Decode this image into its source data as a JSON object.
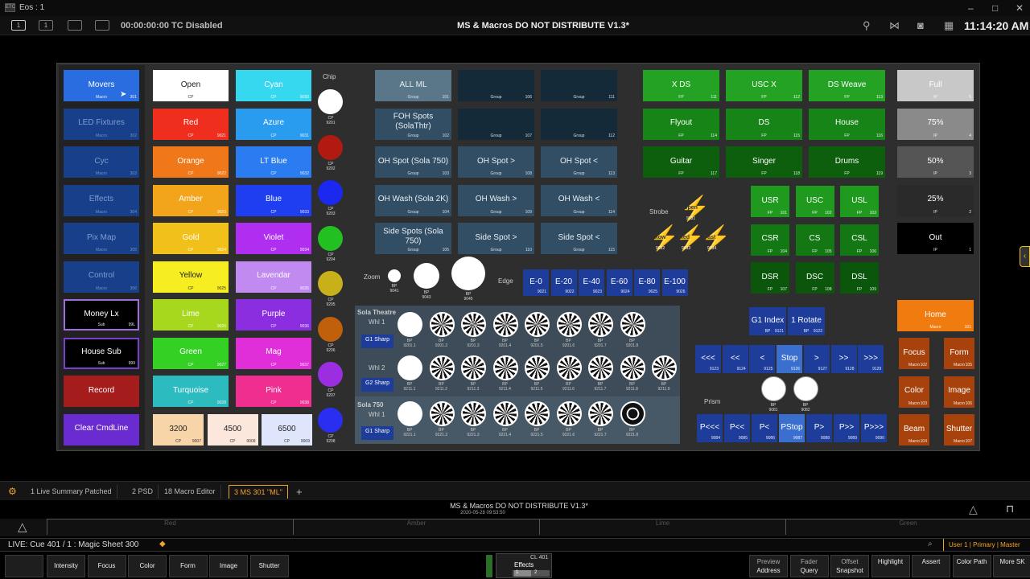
{
  "window": {
    "title": "Eos : 1",
    "logo": "ETC"
  },
  "topbar": {
    "timecode": "00:00:00:00 TC Disabled",
    "show": "MS & Macros DO NOT DISTRIBUTE V1.3*",
    "clock": "11:14:20 AM",
    "icons": [
      "1",
      "1",
      "",
      ""
    ]
  },
  "macros": [
    {
      "label": "Movers",
      "sub": "Macro",
      "num": "301",
      "bg": "#2a6de0",
      "color": "#fff",
      "border": ""
    },
    {
      "label": "LED Fixtures",
      "sub": "Macro",
      "num": "302",
      "bg": "#173f8a",
      "color": "#7f9dd0",
      "border": ""
    },
    {
      "label": "Cyc",
      "sub": "Macro",
      "num": "303",
      "bg": "#173f8a",
      "color": "#7f9dd0",
      "border": ""
    },
    {
      "label": "Effects",
      "sub": "Macro",
      "num": "304",
      "bg": "#173f8a",
      "color": "#7f9dd0",
      "border": ""
    },
    {
      "label": "Pix Map",
      "sub": "Macro",
      "num": "305",
      "bg": "#173f8a",
      "color": "#7f9dd0",
      "border": ""
    },
    {
      "label": "Control",
      "sub": "Macro",
      "num": "306",
      "bg": "#173f8a",
      "color": "#7f9dd0",
      "border": ""
    },
    {
      "label": "Money Lx",
      "sub": "Sub",
      "num": "99L",
      "bg": "#000",
      "color": "#fff",
      "border": "#a06de0"
    },
    {
      "label": "House Sub",
      "sub": "Sub",
      "num": "999",
      "bg": "#000",
      "color": "#fff",
      "border": "#7b3fd0"
    },
    {
      "label": "Record",
      "sub": "",
      "num": "",
      "bg": "#a41c1c",
      "color": "#fff",
      "border": ""
    },
    {
      "label": "Clear CmdLine",
      "sub": "",
      "num": "",
      "bg": "#6a2bd0",
      "color": "#fff",
      "border": ""
    }
  ],
  "colors_left": [
    {
      "label": "Open",
      "num": "",
      "bg": "#ffffff",
      "dark": true
    },
    {
      "label": "Red",
      "num": "9021",
      "bg": "#f02e1e",
      "dark": false
    },
    {
      "label": "Orange",
      "num": "9022",
      "bg": "#f07818",
      "dark": false
    },
    {
      "label": "Amber",
      "num": "9023",
      "bg": "#f2a41a",
      "dark": false
    },
    {
      "label": "Gold",
      "num": "9024",
      "bg": "#f2c01a",
      "dark": false
    },
    {
      "label": "Yellow",
      "num": "9025",
      "bg": "#f6ee20",
      "dark": true
    },
    {
      "label": "Lime",
      "num": "9026",
      "bg": "#a8d81e",
      "dark": false
    },
    {
      "label": "Green",
      "num": "9027",
      "bg": "#34d024",
      "dark": false
    },
    {
      "label": "Turquoise",
      "num": "9028",
      "bg": "#2cbcc0",
      "dark": false
    }
  ],
  "colors_right": [
    {
      "label": "Cyan",
      "num": "9030",
      "bg": "#36d8f0",
      "dark": false
    },
    {
      "label": "Azure",
      "num": "9031",
      "bg": "#2a9cf0",
      "dark": false
    },
    {
      "label": "LT Blue",
      "num": "9032",
      "bg": "#2a7cf0",
      "dark": false
    },
    {
      "label": "Blue",
      "num": "9033",
      "bg": "#1e3ef0",
      "dark": false
    },
    {
      "label": "Violet",
      "num": "9034",
      "bg": "#b02ef0",
      "dark": false
    },
    {
      "label": "Lavendar",
      "num": "9035",
      "bg": "#c08af0",
      "dark": false
    },
    {
      "label": "Purple",
      "num": "9036",
      "bg": "#8a2ee0",
      "dark": false
    },
    {
      "label": "Mag",
      "num": "9037",
      "bg": "#e02ed8",
      "dark": false
    },
    {
      "label": "Pink",
      "num": "9038",
      "bg": "#f02e90",
      "dark": false
    }
  ],
  "ct": [
    {
      "label": "3200",
      "num": "9007",
      "bg": "#f7d5a8"
    },
    {
      "label": "4500",
      "num": "9008",
      "bg": "#fbe7dc"
    },
    {
      "label": "6500",
      "num": "9009",
      "bg": "#dfe6fb"
    }
  ],
  "chips": {
    "title": "Chip",
    "items": [
      {
        "num": "9201",
        "color": "#ffffff"
      },
      {
        "num": "9202",
        "color": "#b01a10"
      },
      {
        "num": "9203",
        "color": "#1a28f0"
      },
      {
        "num": "9204",
        "color": "#22c020"
      },
      {
        "num": "9205",
        "color": "#c8b01a"
      },
      {
        "num": "9206",
        "color": "#c0600a"
      },
      {
        "num": "9207",
        "color": "#9a2ee0"
      },
      {
        "num": "9208",
        "color": "#2a2ef0"
      }
    ],
    "cp": "CP"
  },
  "groups": [
    [
      "ALL ML",
      "Group",
      "101"
    ],
    [
      "",
      "Group",
      "106"
    ],
    [
      "",
      "Group",
      "111"
    ],
    [
      "FOH Spots (SolaThtr)",
      "Group",
      "102"
    ],
    [
      "",
      "Group",
      "107"
    ],
    [
      "",
      "Group",
      "112"
    ],
    [
      "OH Spot (Sola 750)",
      "Group",
      "103"
    ],
    [
      "OH Spot >",
      "Group",
      "108"
    ],
    [
      "OH Spot <",
      "Group",
      "113"
    ],
    [
      "OH Wash (Sola 2K)",
      "Group",
      "104"
    ],
    [
      "OH Wash >",
      "Group",
      "109"
    ],
    [
      "OH Wash <",
      "Group",
      "114"
    ],
    [
      "Side Spots (Sola 750)",
      "Group",
      "105"
    ],
    [
      "Side Spot >",
      "Group",
      "110"
    ],
    [
      "Side Spot <",
      "Group",
      "115"
    ]
  ],
  "zoom": {
    "label": "Zoom",
    "edge": "Edge",
    "bp": "BP",
    "nums": [
      "9041",
      "9043",
      "9045"
    ]
  },
  "edge": [
    [
      "E-0",
      "9021"
    ],
    [
      "E-20",
      "9022"
    ],
    [
      "E-40",
      "9023"
    ],
    [
      "E-60",
      "9024"
    ],
    [
      "E-80",
      "9025"
    ],
    [
      "E-100",
      "9026"
    ]
  ],
  "gobos": {
    "theatre": "Sola Theatre",
    "whl1": "Whl 1",
    "whl2": "Whl 2",
    "s750": "Sola 750",
    "sharp1": "G1 Sharp",
    "sharp2": "G2 Sharp",
    "bp": "BP",
    "n1": [
      "9201.1",
      "9201.2",
      "9201.3",
      "9201.4",
      "9201.5",
      "9201.6",
      "9201.7",
      "9201.8"
    ],
    "n2": [
      "9211.1",
      "9211.2",
      "9211.3",
      "9211.4",
      "9211.5",
      "9211.6",
      "9211.7",
      "9211.8",
      "9211.9"
    ],
    "n3": [
      "9221.1",
      "9221.2",
      "9221.3",
      "9221.4",
      "9221.5",
      "9221.6",
      "9221.7",
      "9221.8"
    ]
  },
  "focus": [
    [
      "X DS",
      "FP",
      "111"
    ],
    [
      "USC X",
      "FP",
      "112"
    ],
    [
      "DS Weave",
      "FP",
      "113"
    ],
    [
      "Flyout",
      "FP",
      "114"
    ],
    [
      "DS",
      "FP",
      "115"
    ],
    [
      "House",
      "FP",
      "116"
    ],
    [
      "Guitar",
      "FP",
      "117"
    ],
    [
      "Singer",
      "FP",
      "118"
    ],
    [
      "Drums",
      "FP",
      "119"
    ]
  ],
  "stage": [
    [
      "USR",
      "FP",
      "101"
    ],
    [
      "USC",
      "FP",
      "102"
    ],
    [
      "USL",
      "FP",
      "103"
    ],
    [
      "CSR",
      "FP",
      "104"
    ],
    [
      "CS",
      "FP",
      "105"
    ],
    [
      "CSL",
      "FP",
      "106"
    ],
    [
      "DSR",
      "FP",
      "107"
    ],
    [
      "DSC",
      "FP",
      "108"
    ],
    [
      "DSL",
      "FP",
      "109"
    ]
  ],
  "strobe": {
    "label": "Strobe",
    "open": "Open",
    "slow": "Slow",
    "med": "Med",
    "fast": "Fast",
    "nums": [
      "9031",
      "9032",
      "9033",
      "9034"
    ]
  },
  "intens": [
    [
      "Full",
      "IP",
      "5"
    ],
    [
      "75%",
      "IP",
      "4"
    ],
    [
      "50%",
      "IP",
      "3"
    ],
    [
      "25%",
      "IP",
      "2"
    ],
    [
      "Out",
      "IP",
      "1"
    ]
  ],
  "index": [
    [
      "G1 Index",
      "BP",
      "9121"
    ],
    [
      "1 Rotate",
      "BP",
      "9122"
    ]
  ],
  "rotate": [
    [
      "<<<",
      "9123"
    ],
    [
      "<<",
      "9124"
    ],
    [
      "<",
      "9125"
    ],
    [
      "Stop",
      "9126"
    ],
    [
      ">",
      "9127"
    ],
    [
      ">>",
      "9128"
    ],
    [
      ">>>",
      "9129"
    ]
  ],
  "prism": {
    "label": "Prism",
    "nums": [
      "9081",
      "9082"
    ],
    "bp": "BP"
  },
  "prismrot": [
    [
      "P<<<",
      "9084"
    ],
    [
      "P<<",
      "9085"
    ],
    [
      "P<",
      "9086"
    ],
    [
      "PStop",
      "9087"
    ],
    [
      "P>",
      "9088"
    ],
    [
      "P>>",
      "9089"
    ],
    [
      "P>>>",
      "9090"
    ]
  ],
  "home": {
    "label": "Home",
    "sub": "Macro",
    "num": "101"
  },
  "attrmacros": [
    [
      "Focus",
      "Macro",
      "102"
    ],
    [
      "Form",
      "Macro",
      "105"
    ],
    [
      "Color",
      "Macro",
      "103"
    ],
    [
      "Image",
      "Macro",
      "106"
    ],
    [
      "Beam",
      "Macro",
      "104"
    ],
    [
      "Shutter",
      "Macro",
      "107"
    ]
  ],
  "tabs": [
    "1 Live Summary Patched",
    "2 PSD",
    "18 Macro Editor",
    "3 MS 301 \"ML\"",
    "+"
  ],
  "status": {
    "show": "MS & Macros DO NOT DISTRIBUTE V1.3*",
    "date": "2020-05-28 09:53:50",
    "faders": [
      "Red",
      "Amber",
      "Lime",
      "Green"
    ]
  },
  "cmdline": {
    "text": "LIVE: Cue  401 / 1 :  Magic Sheet 300",
    "user": "User 1 | Primary | Master"
  },
  "softkeys": [
    "Intensity",
    "Focus",
    "Color",
    "Form",
    "Image",
    "Shutter"
  ],
  "cue": {
    "cl": "CL 401",
    "label": "Effects",
    "n1": "1",
    "n2": "2"
  },
  "rightkeys": [
    [
      "Preview",
      "Address"
    ],
    [
      "Fader",
      "Query"
    ],
    [
      "Offset",
      "Snapshot"
    ],
    [
      "",
      "Highlight"
    ],
    [
      "",
      "Assert"
    ],
    [
      "",
      "Color Path"
    ],
    [
      "",
      "More SK"
    ]
  ]
}
